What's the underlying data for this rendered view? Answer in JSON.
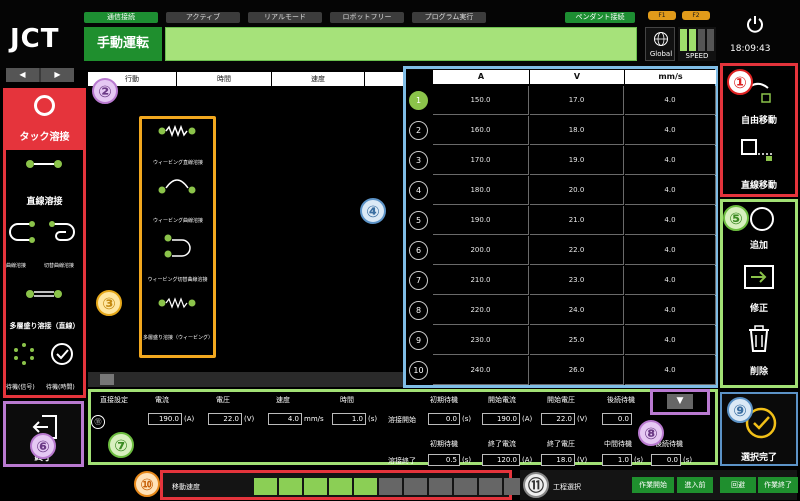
{
  "header": {
    "logo": "JCT",
    "status_tabs": [
      "通信接続",
      "アクティブ",
      "リアルモード",
      "ロボットフリー",
      "プログラム実行",
      "ペンダント接続"
    ],
    "mode_label": "手動運転",
    "pill_labels": [
      "F1",
      "F2"
    ],
    "global_label": "Global",
    "speed_label": "SPEED",
    "clock": "18:09:43"
  },
  "left_panel": {
    "items": [
      {
        "label": "タック溶接"
      },
      {
        "label": "直線溶接"
      },
      {
        "label": "曲線溶接"
      },
      {
        "label": "切替曲線溶接"
      },
      {
        "label": "多層盛り溶接（直線）"
      },
      {
        "label": "待機(信号)"
      },
      {
        "label": "待機(時間)"
      }
    ],
    "exit_label": "終了"
  },
  "center": {
    "columns": [
      "行動",
      "時間",
      "速度"
    ],
    "weld_items": [
      "ウィービング直線溶接",
      "ウィービング曲線溶接",
      "ウィービング切替曲線溶接",
      "多層盛り溶接（ウィービング）"
    ]
  },
  "table": {
    "headers": [
      "A",
      "V",
      "mm/s"
    ],
    "rows": [
      {
        "n": "1",
        "a": "150.0",
        "v": "17.0",
        "s": "4.0"
      },
      {
        "n": "2",
        "a": "160.0",
        "v": "18.0",
        "s": "4.0"
      },
      {
        "n": "3",
        "a": "170.0",
        "v": "19.0",
        "s": "4.0"
      },
      {
        "n": "4",
        "a": "180.0",
        "v": "20.0",
        "s": "4.0"
      },
      {
        "n": "5",
        "a": "190.0",
        "v": "21.0",
        "s": "4.0"
      },
      {
        "n": "6",
        "a": "200.0",
        "v": "22.0",
        "s": "4.0"
      },
      {
        "n": "7",
        "a": "210.0",
        "v": "23.0",
        "s": "4.0"
      },
      {
        "n": "8",
        "a": "220.0",
        "v": "24.0",
        "s": "4.0"
      },
      {
        "n": "9",
        "a": "230.0",
        "v": "25.0",
        "s": "4.0"
      },
      {
        "n": "10",
        "a": "240.0",
        "v": "26.0",
        "s": "4.0"
      }
    ]
  },
  "right_panel": {
    "free_move": "自由移動",
    "linear_move": "直線移動",
    "add": "追加",
    "modify": "修正",
    "delete": "削除",
    "select_done": "選択完了"
  },
  "settings": {
    "title": "直接設定",
    "labels": {
      "current": "電流",
      "voltage": "電圧",
      "speed": "速度",
      "time": "時間",
      "init_wait": "初期待機",
      "start_current": "開始電流",
      "start_voltage": "開始電圧",
      "back_wait": "後続待機",
      "weld_start": "溶接開始",
      "weld_end": "溶接終了",
      "init_wait2": "初期待機",
      "end_current": "終了電流",
      "end_voltage": "終了電圧",
      "mid_wait": "中間待機",
      "after_wait": "後続待機"
    },
    "values": {
      "current": "190.0",
      "voltage": "22.0",
      "speed": "4.0",
      "time": "1.0",
      "init_wait": "0.0",
      "start_current": "190.0",
      "start_voltage": "22.0",
      "back_wait": "0.0",
      "init_wait2": "0.5",
      "end_current": "120.0",
      "end_voltage": "18.0",
      "mid_wait": "1.0",
      "after_wait": "0.0"
    },
    "units": {
      "a": "(A)",
      "v": "(V)",
      "mms": "mm/s",
      "s": "(s)"
    }
  },
  "footer": {
    "move_speed_label": "移動速度",
    "speed_segments": 11,
    "speed_on": 5,
    "process_select": "工程選択",
    "buttons": [
      "作業開始",
      "進入前",
      "回避",
      "作業終了"
    ]
  },
  "badges": [
    "①",
    "②",
    "③",
    "④",
    "⑤",
    "⑥",
    "⑦",
    "⑧",
    "⑨",
    "⑩",
    "⑪"
  ],
  "colors": {
    "accent_green": "#1f8f2e",
    "light_green": "#a6e27a",
    "red": "#e5343c",
    "orange": "#f2a81f",
    "blue": "#7fbde6"
  }
}
